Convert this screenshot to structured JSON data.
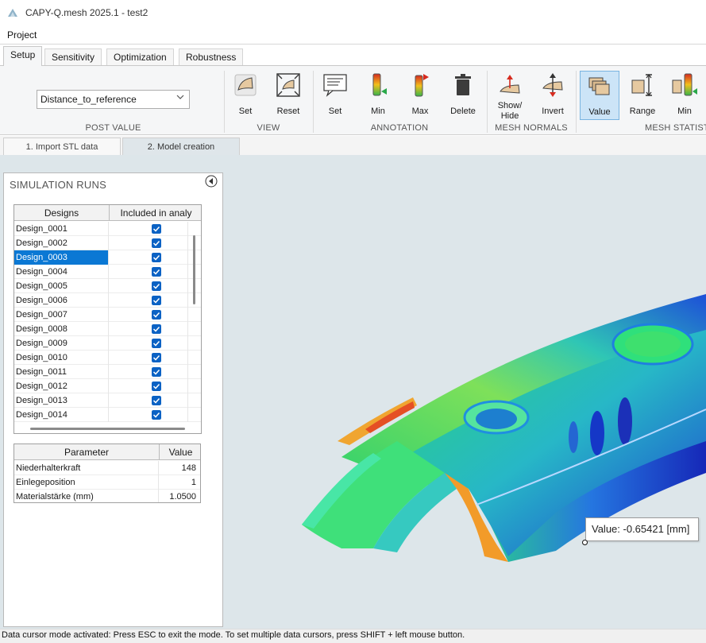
{
  "window": {
    "title": "CAPY-Q.mesh 2025.1 - test2",
    "app_icon": "capy-logo-icon"
  },
  "menu": {
    "items": [
      "Project"
    ]
  },
  "ribbon_tabs": [
    {
      "label": "Setup",
      "active": true
    },
    {
      "label": "Sensitivity",
      "active": false
    },
    {
      "label": "Optimization",
      "active": false
    },
    {
      "label": "Robustness",
      "active": false
    }
  ],
  "ribbon": {
    "post_value": {
      "selected": "Distance_to_reference",
      "group_label": "POST VALUE"
    },
    "view": {
      "group_label": "VIEW",
      "set_label": "Set",
      "reset_label": "Reset"
    },
    "annotation": {
      "group_label": "ANNOTATION",
      "set_label": "Set",
      "min_label": "Min",
      "max_label": "Max",
      "delete_label": "Delete"
    },
    "mesh_normals": {
      "group_label": "MESH NORMALS",
      "show_hide_label_1": "Show/",
      "show_hide_label_2": "Hide",
      "invert_label": "Invert"
    },
    "mesh_statistics": {
      "group_label": "MESH STATIST",
      "value_label": "Value",
      "range_label": "Range",
      "min_label": "Min"
    }
  },
  "step_tabs": [
    {
      "label": "1. Import STL data",
      "active": false
    },
    {
      "label": "2. Model creation",
      "active": true
    }
  ],
  "panel": {
    "title": "SIMULATION RUNS",
    "designs_grid": {
      "columns": [
        "Designs",
        "Included in analy"
      ],
      "rows": [
        {
          "name": "Design_0001",
          "included": true
        },
        {
          "name": "Design_0002",
          "included": true
        },
        {
          "name": "Design_0003",
          "included": true,
          "selected": true
        },
        {
          "name": "Design_0004",
          "included": true
        },
        {
          "name": "Design_0005",
          "included": true
        },
        {
          "name": "Design_0006",
          "included": true
        },
        {
          "name": "Design_0007",
          "included": true
        },
        {
          "name": "Design_0008",
          "included": true
        },
        {
          "name": "Design_0009",
          "included": true
        },
        {
          "name": "Design_0010",
          "included": true
        },
        {
          "name": "Design_0011",
          "included": true
        },
        {
          "name": "Design_0012",
          "included": true
        },
        {
          "name": "Design_0013",
          "included": true
        },
        {
          "name": "Design_0014",
          "included": true
        }
      ]
    },
    "params_grid": {
      "columns": [
        "Parameter",
        "Value"
      ],
      "rows": [
        {
          "name": "Niederhalterkraft",
          "value": "148"
        },
        {
          "name": "Einlegeposition",
          "value": "1"
        },
        {
          "name": "Materialstärke (mm)",
          "value": "1.0500"
        }
      ]
    }
  },
  "viewport": {
    "tooltip": "Value: -0.65421 [mm]",
    "background": "#dde6ea"
  },
  "status_bar": {
    "text": "Data cursor mode activated: Press ESC to exit the mode. To set multiple data cursors, press SHIFT + left mouse button."
  },
  "colors": {
    "accent": "#0b78d4",
    "selected_button": "#cce4f7",
    "checkbox": "#0b62c4"
  }
}
